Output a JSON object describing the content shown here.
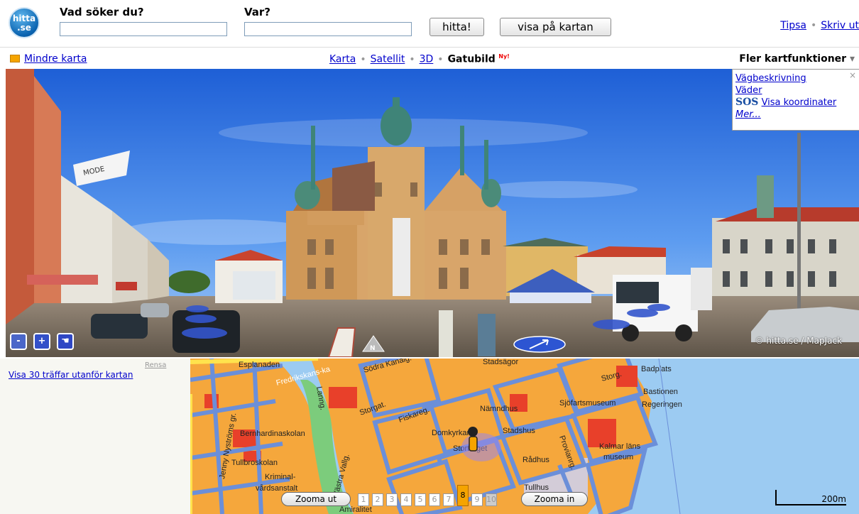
{
  "header": {
    "logo_text": "hitta.se",
    "what_label": "Vad söker du?",
    "what_value": "",
    "where_label": "Var?",
    "where_value": "",
    "search_button": "hitta!",
    "map_button": "visa på kartan",
    "tipsa_link": "Tipsa",
    "skriv_link": "Skriv ut"
  },
  "subnav": {
    "mindre_link": "Mindre karta",
    "views": [
      {
        "label": "Karta"
      },
      {
        "label": "Satellit"
      },
      {
        "label": "3D"
      },
      {
        "label": "Gatubild",
        "badge": "Ny!",
        "active": true
      }
    ],
    "fler_label": "Fler kartfunktioner",
    "fler_arrow": "▾"
  },
  "popup": {
    "items": [
      "Vägbeskrivning",
      "Väder",
      "Visa koordinater",
      "Mer..."
    ],
    "sos_text": "SOS",
    "close": "×"
  },
  "photo": {
    "copyright": "© hitta.se / MapJack",
    "compass": "N",
    "shop_sign": "MODE"
  },
  "results": {
    "clear_link": "Rensa",
    "outside_link": "Visa 30 träffar utanför kartan"
  },
  "map": {
    "labels": {
      "esplanaden": "Esplanaden",
      "fredrikskans": "Fredrikskans-ka",
      "sodra": "Södra Kanalg.",
      "stadsagor": "Stadsägor",
      "badplats": "Badplats",
      "bastionen": "Bastionen",
      "regeringen": "Regeringen",
      "storg": "Storg.",
      "storgatan": "Storgat.",
      "fiskareg": "Fiskareg.",
      "namndhus": "Nämndhus",
      "sjofart": "Sjöfartsmuseum",
      "bernhardina": "Bernhardinaskolan",
      "domkyrkan": "Domkyrkan",
      "stadshus": "Stadshus",
      "stortorget": "Stortorget",
      "tullbro": "Tullbroskolan",
      "kriminal": "Kriminal-",
      "vardsanstalt": "vårdsanstalt",
      "radhus": "Rådhus",
      "kalmar": "Kalmar läns",
      "museum": "museum",
      "tullhus": "Tullhus",
      "provianrg": "Provianrg.",
      "lanng": "Lanng.",
      "vastra": "Västra Vallg.",
      "jenny": "Jenny Nyströms gr.",
      "amiralitet": "Amiralitet"
    },
    "zoom_out": "Zooma ut",
    "zoom_in": "Zooma in",
    "zoom_levels": [
      "1",
      "2",
      "3",
      "4",
      "5",
      "6",
      "7",
      "8",
      "9",
      "10"
    ],
    "zoom_current": 8,
    "scale": "200m"
  },
  "colors": {
    "link": "#0000cc",
    "block": "#f5a73c",
    "road": "#6b8fd9",
    "building": "#e8402a",
    "water": "#9ccbf2",
    "park": "#7ccc7c"
  }
}
